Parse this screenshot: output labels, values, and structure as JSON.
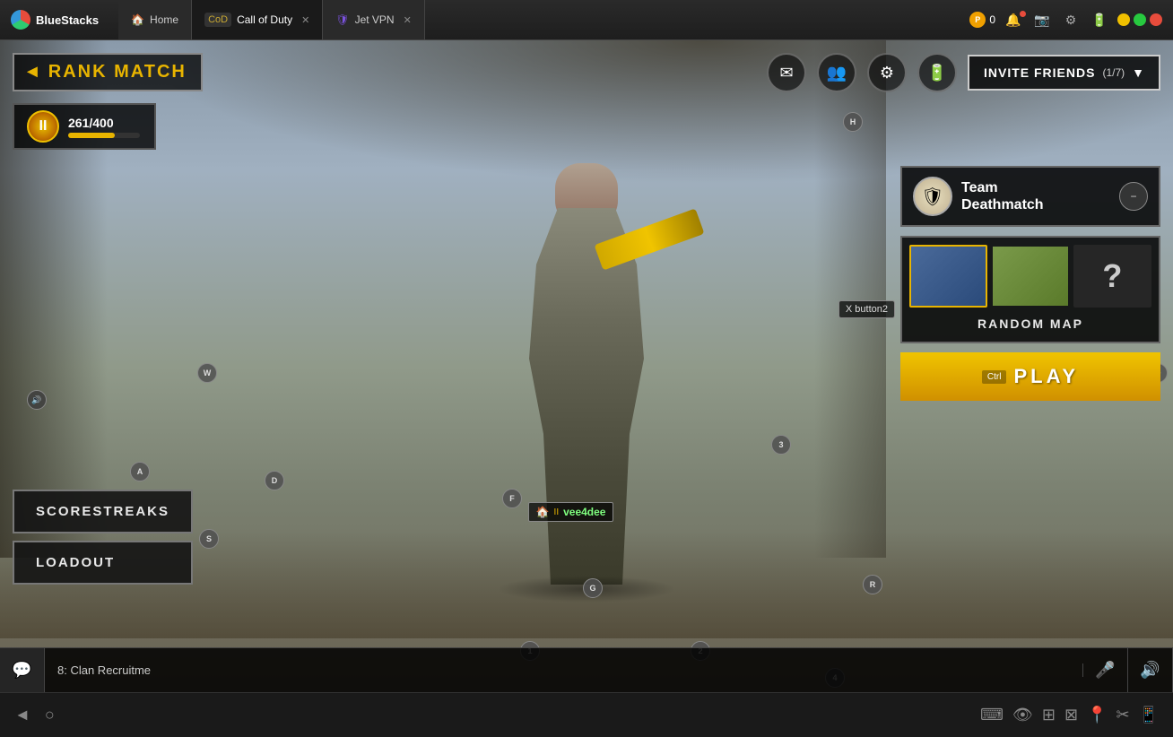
{
  "titlebar": {
    "app_name": "BlueStacks",
    "tabs": [
      {
        "id": "home",
        "label": "Home",
        "icon": "🏠",
        "active": false
      },
      {
        "id": "cod",
        "label": "Call of Duty",
        "icon": "⚔",
        "active": true
      },
      {
        "id": "vpn",
        "label": "Jet VPN",
        "icon": "🛡",
        "active": false
      }
    ],
    "coin_value": "0",
    "window_controls": {
      "minimize": "−",
      "maximize": "□",
      "close": "✕"
    }
  },
  "game": {
    "mode_title": "RANK MATCH",
    "back_label": "◄",
    "rank_level": "II",
    "xp_current": 261,
    "xp_max": 400,
    "xp_label": "261/400",
    "xp_percent": 65,
    "invite_btn": "INVITE FRIENDS",
    "invite_count": "(1/7)",
    "player_name": "vee4dee",
    "chat_channel": "8: Clan Recruitme",
    "scorestreaks_label": "SCORESTREAKS",
    "loadout_label": "LOADOUT",
    "mode_name_line1": "Team",
    "mode_name_line2": "Deathmatch",
    "random_map_label": "RANDOM MAP",
    "play_ctrl": "Ctrl",
    "play_label": "PLAY",
    "x_hint": "X button2",
    "kbd_hints": [
      "H",
      "W",
      "A",
      "D",
      "F",
      "S",
      "G",
      "R",
      "Q",
      "3",
      "2",
      "1",
      "4"
    ]
  },
  "bottombar": {
    "icons": [
      "◄",
      "○",
      "⌨",
      "👁",
      "⊞",
      "⊠",
      "📍",
      "✂",
      "📱"
    ]
  }
}
